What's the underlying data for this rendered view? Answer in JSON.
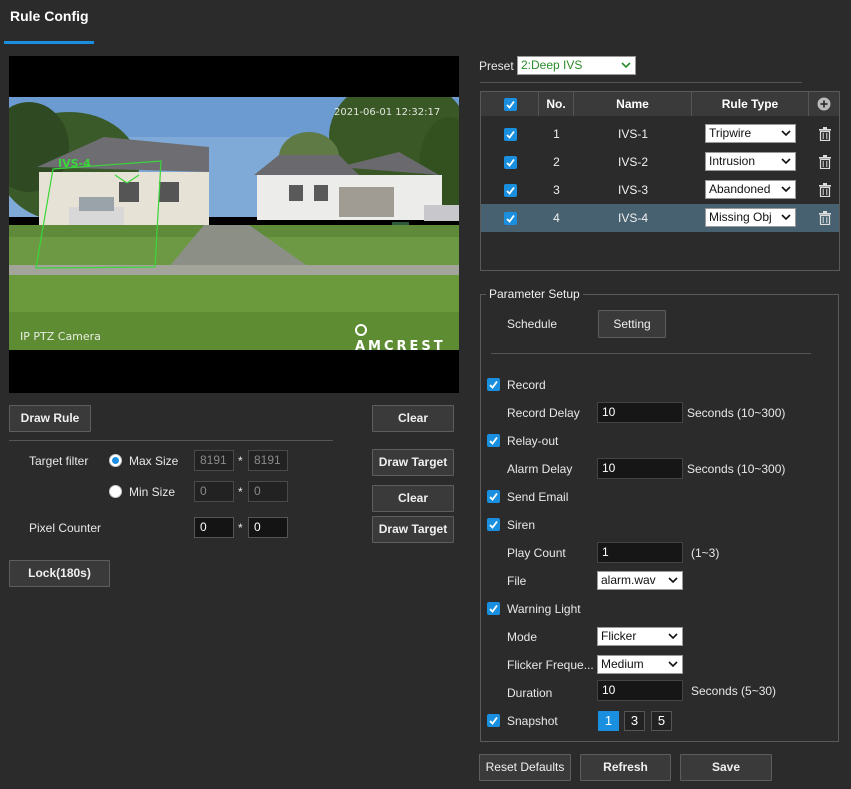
{
  "header": {
    "title": "Rule Config"
  },
  "video": {
    "timestamp": "2021-06-01 12:32:17",
    "camera_name": "IP PTZ Camera",
    "brand": "AMCREST",
    "rule_overlay_label": "IVS-4"
  },
  "left": {
    "draw_rule_label": "Draw Rule",
    "clear_label": "Clear",
    "target_filter_label": "Target filter",
    "max_size_label": "Max Size",
    "max_w": "8191",
    "max_h": "8191",
    "min_size_label": "Min Size",
    "min_w": "0",
    "min_h": "0",
    "times": "*",
    "draw_target_label": "Draw Target",
    "pixel_counter_label": "Pixel Counter",
    "pixel_w": "0",
    "pixel_h": "0",
    "lock_label": "Lock(180s)"
  },
  "preset": {
    "label": "Preset",
    "value": "2:Deep IVS"
  },
  "rules_table": {
    "headers": {
      "no": "No.",
      "name": "Name",
      "rule_type": "Rule Type"
    },
    "rows": [
      {
        "no": "1",
        "name": "IVS-1",
        "rule_type": "Tripwire",
        "checked": true
      },
      {
        "no": "2",
        "name": "IVS-2",
        "rule_type": "Intrusion",
        "checked": true
      },
      {
        "no": "3",
        "name": "IVS-3",
        "rule_type": "Abandoned",
        "checked": true
      },
      {
        "no": "4",
        "name": "IVS-4",
        "rule_type": "Missing Obj",
        "checked": true,
        "selected": true
      }
    ]
  },
  "params": {
    "legend": "Parameter Setup",
    "schedule_label": "Schedule",
    "setting_label": "Setting",
    "record_label": "Record",
    "record_delay_label": "Record Delay",
    "record_delay_value": "10",
    "record_delay_unit": "Seconds (10~300)",
    "relay_out_label": "Relay-out",
    "alarm_delay_label": "Alarm Delay",
    "alarm_delay_value": "10",
    "alarm_delay_unit": "Seconds (10~300)",
    "send_email_label": "Send Email",
    "siren_label": "Siren",
    "play_count_label": "Play Count",
    "play_count_value": "1",
    "play_count_range": "(1~3)",
    "file_label": "File",
    "file_value": "alarm.wav",
    "warning_light_label": "Warning Light",
    "mode_label": "Mode",
    "mode_value": "Flicker",
    "flicker_freq_label": "Flicker Freque...",
    "flicker_freq_value": "Medium",
    "duration_label": "Duration",
    "duration_value": "10",
    "duration_unit": "Seconds (5~30)",
    "snapshot_label": "Snapshot",
    "snapshot_options": [
      "1",
      "3",
      "5"
    ],
    "snapshot_selected": "1"
  },
  "footer": {
    "reset_label": "Reset Defaults",
    "refresh_label": "Refresh",
    "save_label": "Save"
  },
  "colors": {
    "accent": "#1a8fe0",
    "selected_row": "#486170",
    "background": "#2b2b2b",
    "overlay_green": "#3ad63a"
  }
}
